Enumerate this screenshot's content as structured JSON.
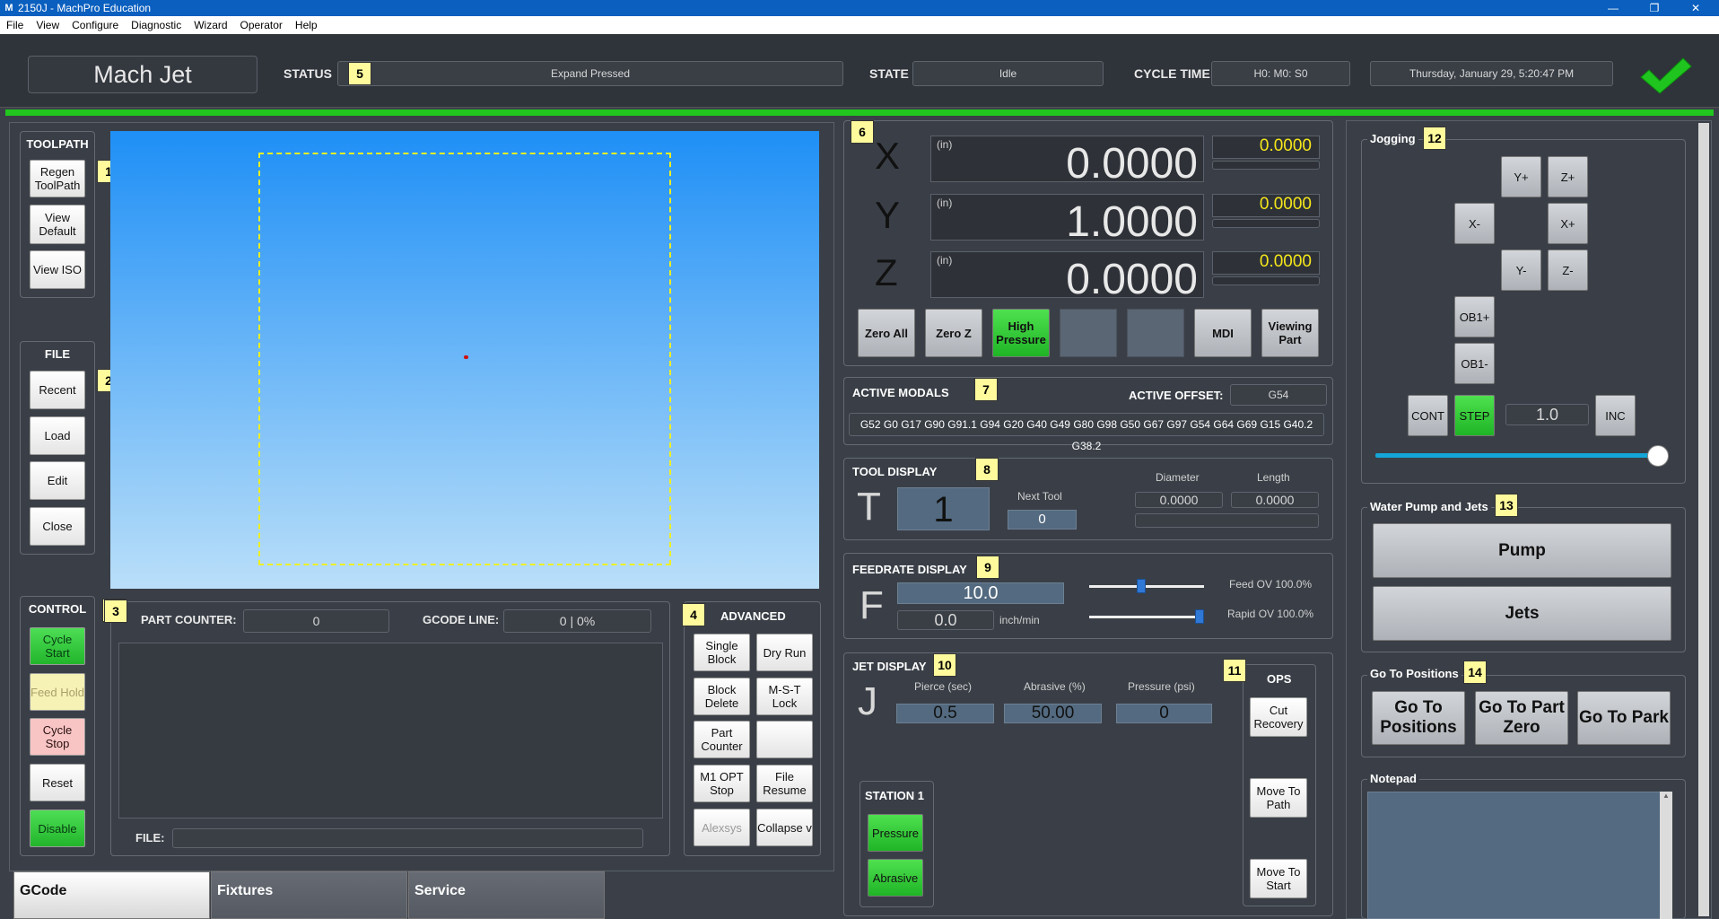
{
  "window": {
    "title": "2150J - MachPro Education",
    "app_icon": "M",
    "minimize": "—",
    "restore": "❐",
    "close": "✕"
  },
  "menu": [
    "File",
    "View",
    "Configure",
    "Diagnostic",
    "Wizard",
    "Operator",
    "Help"
  ],
  "header": {
    "brand": "Mach Jet",
    "status_label": "STATUS",
    "status_tag": "5",
    "status_value": "Expand Pressed",
    "state_label": "STATE",
    "state_value": "Idle",
    "cycle_label": "CYCLE TIME",
    "cycle_value": "H0: M0: S0",
    "datetime": "Thursday, January 29, 5:20:47 PM",
    "ok_icon": "checkmark-icon"
  },
  "toolpath": {
    "title": "TOOLPATH",
    "tag": "1",
    "buttons": [
      "Regen ToolPath",
      "View Default",
      "View ISO"
    ]
  },
  "file": {
    "title": "FILE",
    "tag": "2",
    "buttons": [
      "Recent",
      "Load",
      "Edit",
      "Close"
    ]
  },
  "control": {
    "title": "CONTROL",
    "tag": "3",
    "buttons": [
      "Cycle Start",
      "Feed Hold",
      "Cycle Stop",
      "Reset",
      "Disable"
    ]
  },
  "gcode": {
    "part_counter_label": "PART COUNTER:",
    "part_counter_value": "0",
    "gcode_line_label": "GCODE LINE:",
    "gcode_line_value": "0 | 0%",
    "file_label": "FILE:",
    "file_value": ""
  },
  "advanced": {
    "title": "ADVANCED",
    "tag": "4",
    "buttons": [
      "Single Block",
      "Dry Run",
      "Block Delete",
      "M-S-T Lock",
      "Part Counter",
      "",
      "M1 OPT Stop",
      "File Resume",
      "Alexsys",
      "Collapse v"
    ]
  },
  "tabs": [
    "GCode",
    "Fixtures",
    "Service"
  ],
  "dro": {
    "tag": "6",
    "unit": "(in)",
    "axes": [
      {
        "name": "X",
        "value": "0.0000",
        "offset": "0.0000"
      },
      {
        "name": "Y",
        "value": "1.0000",
        "offset": "0.0000"
      },
      {
        "name": "Z",
        "value": "0.0000",
        "offset": "0.0000"
      }
    ],
    "buttons": [
      "Zero All",
      "Zero Z",
      "High Pressure",
      "",
      "",
      "MDI",
      "Viewing Part"
    ]
  },
  "modals": {
    "title": "ACTIVE MODALS",
    "tag": "7",
    "offset_label": "ACTIVE OFFSET:",
    "offset_value": "G54",
    "codes": "G52 G0 G17 G90 G91.1 G94 G20 G40 G49 G80 G98 G50 G67 G97 G54 G64 G69 G15 G40.2 G38.2"
  },
  "tool": {
    "title": "TOOL DISPLAY",
    "tag": "8",
    "letter": "T",
    "value": "1",
    "next_label": "Next Tool",
    "next_value": "0",
    "diameter_label": "Diameter",
    "diameter_value": "0.0000",
    "length_label": "Length",
    "length_value": "0.0000",
    "desc": ""
  },
  "feed": {
    "title": "FEEDRATE DISPLAY",
    "tag": "9",
    "letter": "F",
    "value": "10.0",
    "actual": "0.0",
    "unit": "inch/min",
    "feed_ov_label": "Feed OV 100.0%",
    "rapid_ov_label": "Rapid OV 100.0%",
    "feed_ov": 0.45,
    "rapid_ov": 1.0
  },
  "jet": {
    "title": "JET DISPLAY",
    "tag": "10",
    "letter": "J",
    "pierce_label": "Pierce (sec)",
    "pierce_value": "0.5",
    "abrasive_label": "Abrasive (%)",
    "abrasive_value": "50.00",
    "pressure_label": "Pressure (psi)",
    "pressure_value": "0"
  },
  "station": {
    "title": "STATION 1",
    "buttons": [
      "Pressure",
      "Abrasive"
    ]
  },
  "ops": {
    "title": "OPS",
    "tag": "11",
    "buttons": [
      "Cut Recovery",
      "Move To Path",
      "Move To Start"
    ]
  },
  "jogging": {
    "title": "Jogging",
    "tag": "12",
    "buttons": {
      "yp": "Y+",
      "zp": "Z+",
      "xm": "X-",
      "xp": "X+",
      "ym": "Y-",
      "zm": "Z-",
      "ob1p": "OB1+",
      "ob1m": "OB1-"
    },
    "cont": "CONT",
    "step": "STEP",
    "inc_value": "1.0",
    "inc": "INC",
    "rate": 1.0
  },
  "pump": {
    "title": "Water Pump and Jets",
    "tag": "13",
    "buttons": [
      "Pump",
      "Jets"
    ]
  },
  "goto": {
    "title": "Go To Positions",
    "tag": "14",
    "buttons": [
      "Go To Positions",
      "Go To Part Zero",
      "Go To Park"
    ]
  },
  "notepad": {
    "title": "Notepad",
    "text": ""
  }
}
